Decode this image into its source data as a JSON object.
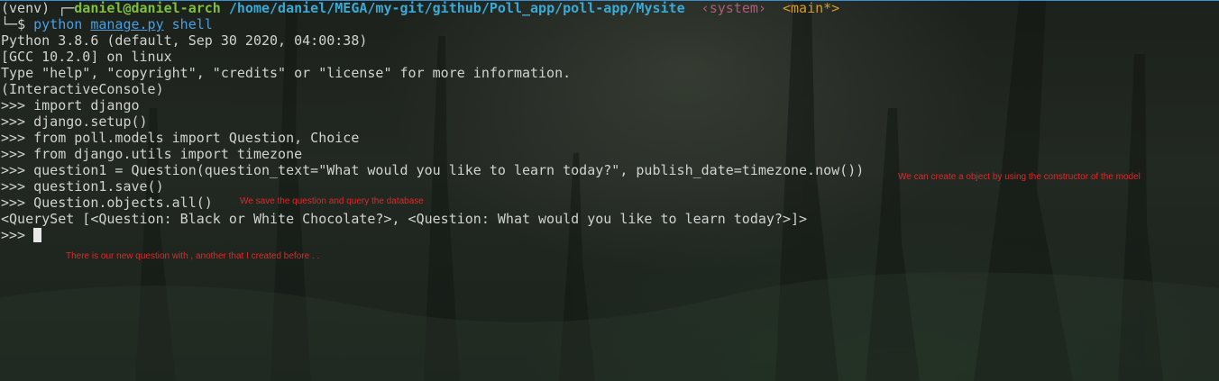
{
  "prompt": {
    "venv": "(venv) ",
    "corner": "┌─",
    "user_host": "daniel@daniel-arch",
    "path": "/home/daniel/MEGA/my-git/github/Poll_app/poll-app/Mysite",
    "env_badge": "‹system›",
    "branch": "<main*>",
    "corner2": "└─",
    "dollar": "$ "
  },
  "command": {
    "program": "python",
    "file": "manage.py",
    "arg": "shell"
  },
  "output": [
    "Python 3.8.6 (default, Sep 30 2020, 04:00:38)",
    "[GCC 10.2.0] on linux",
    "Type \"help\", \"copyright\", \"credits\" or \"license\" for more information.",
    "(InteractiveConsole)",
    ">>> import django",
    ">>> django.setup()",
    ">>> from poll.models import Question, Choice",
    ">>> from django.utils import timezone",
    ">>> question1 = Question(question_text=\"What would you like to learn today?\", publish_date=timezone.now())",
    ">>> question1.save()",
    ">>> Question.objects.all()",
    "<QuerySet [<Question: Black or White Chocolate?>, <Question: What would you like to learn today?>]>"
  ],
  "current_prompt": ">>> ",
  "annotations": {
    "constructor": "We can create a object by using the constructor of the model",
    "save": "We save the question and query the database",
    "new_question": "There is our new question with , another that I created before  . ."
  },
  "colors": {
    "background": "#1c211c",
    "text": "#d0d3cf",
    "user_host": "#7fbf3f",
    "path": "#3aa9d6",
    "command": "#4a9fe0",
    "env_badge": "#b05a7a",
    "branch": "#d59a2a",
    "annotation": "#e02828"
  }
}
